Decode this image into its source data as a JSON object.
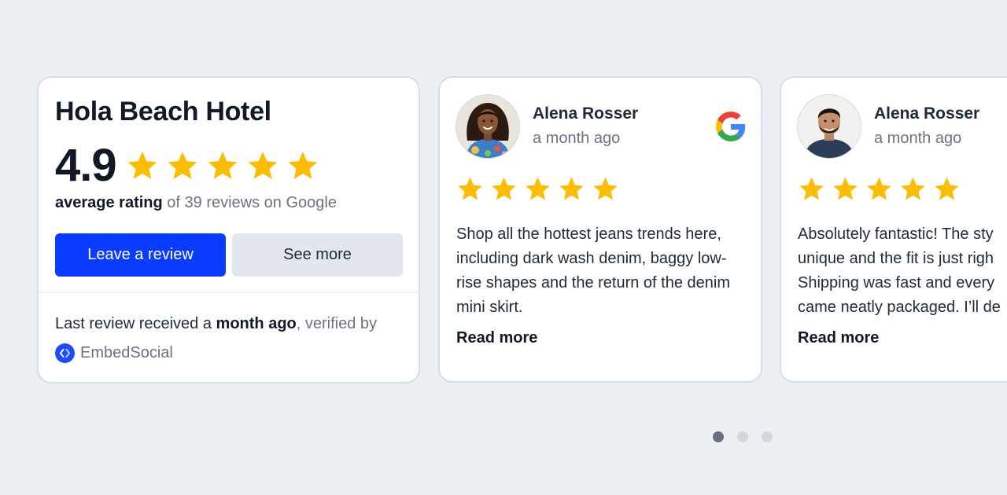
{
  "colors": {
    "page_bg": "#eceff4",
    "card_bg": "#ffffff",
    "card_border": "#d7dce3",
    "primary": "#0a3cff",
    "star": "#fbbc05",
    "secondary_btn": "#e2e6ee",
    "muted_text": "#6b7280",
    "dot_active": "#667085",
    "dot_inactive": "#d2d7df"
  },
  "summary": {
    "hotel_name": "Hola Beach Hotel",
    "rating": "4.9",
    "star_count": 5,
    "avg_label": "average rating",
    "reviews_text": " of 39 reviews on Google",
    "leave_review_label": "Leave a review",
    "see_more_label": "See more",
    "footer_prefix": "Last review received a ",
    "footer_bold": "month ago",
    "footer_suffix": ", verified by",
    "brand_name": "EmbedSocial",
    "brand_icon": "embedsocial-logo-icon"
  },
  "reviews": [
    {
      "name": "Alena Rosser",
      "time": "a month ago",
      "rating": 5,
      "source_icon": "google-icon",
      "text": "Shop all the hottest jeans trends here, including dark wash denim, baggy low-rise shapes and the return of the denim mini skirt.",
      "read_more": "Read more"
    },
    {
      "name": "Alena Rosser",
      "time": "a month ago",
      "rating": 5,
      "source_icon": "google-icon",
      "text_lines": [
        "Absolutely fantastic! The sty",
        "unique and the fit is just righ",
        "Shipping was fast and every",
        "came neatly packaged. I’ll de"
      ],
      "read_more": "Read more"
    }
  ],
  "pagination": {
    "pages": 3,
    "active": 1
  }
}
